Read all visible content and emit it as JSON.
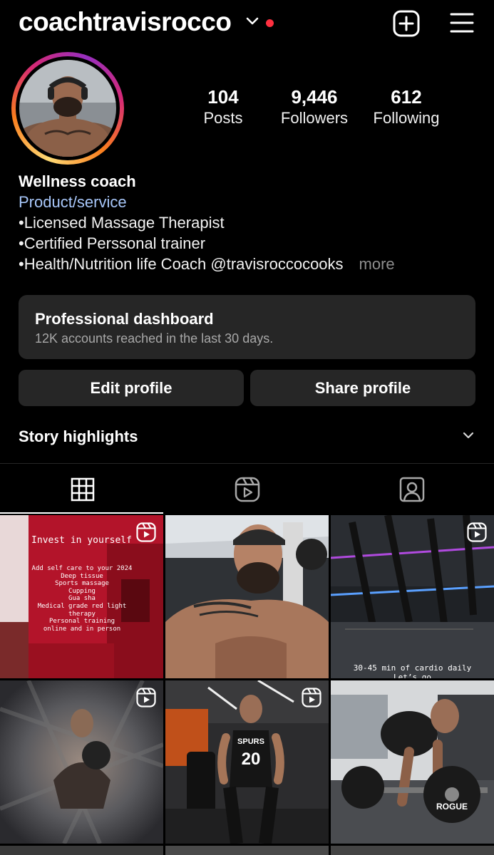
{
  "header": {
    "username": "coachtravisrocco"
  },
  "stats": {
    "posts": {
      "value": "104",
      "label": "Posts"
    },
    "followers": {
      "value": "9,446",
      "label": "Followers"
    },
    "following": {
      "value": "612",
      "label": "Following"
    }
  },
  "bio": {
    "name": "Wellness coach",
    "category": "Product/service",
    "lines": [
      "•Licensed  Massage Therapist",
      "•Certified  Perssonal trainer",
      "•Health/Nutrition life Coach @travisroccocooks"
    ],
    "more": "more"
  },
  "dashboard": {
    "title": "Professional dashboard",
    "subtitle": "12K accounts reached in the last 30 days."
  },
  "actions": {
    "edit": "Edit profile",
    "share": "Share profile"
  },
  "highlights": {
    "label": "Story highlights"
  },
  "tabs": [
    {
      "icon": "grid-icon",
      "active": true
    },
    {
      "icon": "reels-icon",
      "active": false
    },
    {
      "icon": "tagged-icon",
      "active": false
    }
  ],
  "grid": {
    "post1": {
      "title": "Invest in yourself",
      "lines": [
        "Add self care to your 2024",
        "Deep tissue",
        "Sports massage",
        "Cupping",
        "Gua sha",
        "Medical grade red light",
        "therapy",
        "Personal training",
        "online and in person"
      ]
    },
    "post3": {
      "lines": [
        "30-45 min of cardio daily",
        "Let’s go"
      ]
    },
    "post5": {
      "jersey": "20",
      "team": "SPURS"
    },
    "post6": {
      "plate": "ROGUE"
    }
  },
  "colors": {
    "background": "#000000",
    "surface": "#262626",
    "link": "#a8c7fa",
    "notification": "#ff3040"
  }
}
